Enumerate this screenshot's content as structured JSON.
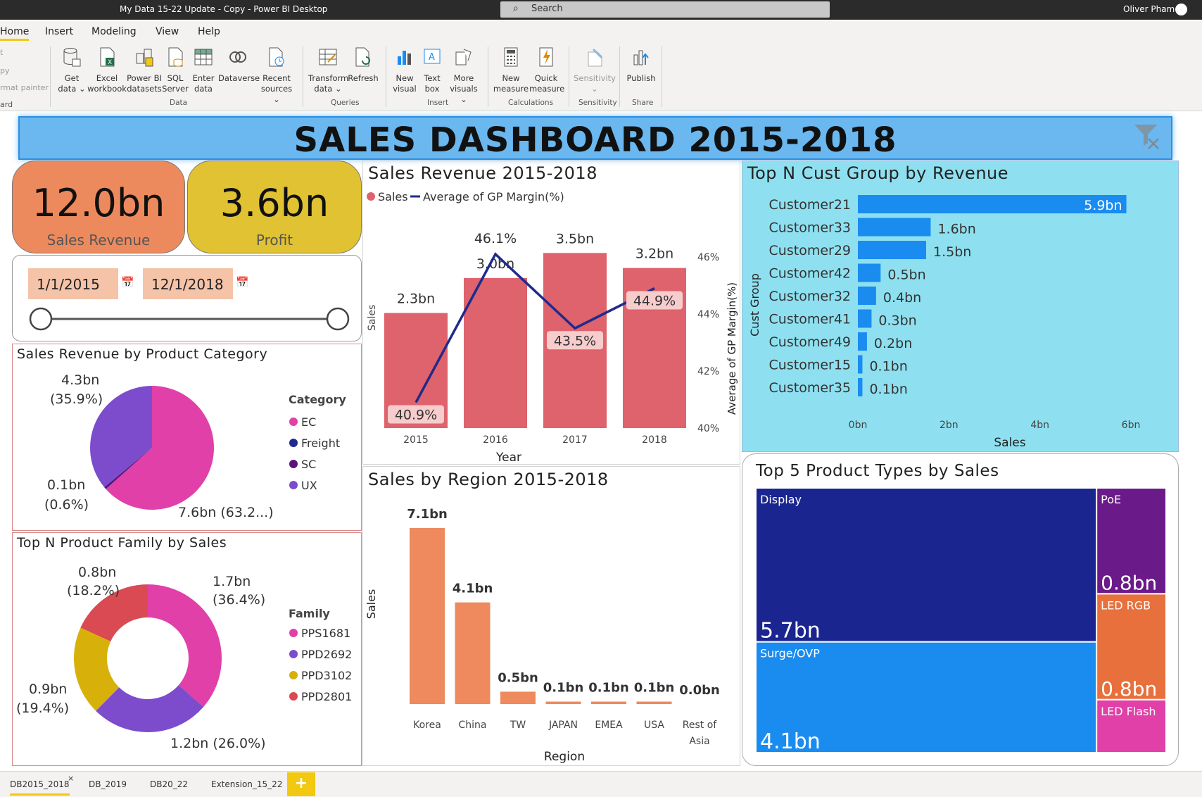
{
  "window": {
    "title": "My Data 15-22 Update - Copy - Power BI Desktop",
    "search_placeholder": "Search",
    "user": "Oliver Pham"
  },
  "menu": [
    "Home",
    "Insert",
    "Modeling",
    "View",
    "Help"
  ],
  "ribbon": {
    "clipboard": [
      "t",
      "py",
      "rmat painter",
      "ard"
    ],
    "buttons": [
      {
        "l1": "Get",
        "l2": "data ⌄",
        "icon": "database-icon"
      },
      {
        "l1": "Excel",
        "l2": "workbook",
        "icon": "excel-icon"
      },
      {
        "l1": "Power BI",
        "l2": "datasets",
        "icon": "dataset-icon"
      },
      {
        "l1": "SQL",
        "l2": "Server",
        "icon": "sql-server-icon"
      },
      {
        "l1": "Enter",
        "l2": "data",
        "icon": "table-icon"
      },
      {
        "l1": "Dataverse",
        "l2": "",
        "icon": "dataverse-icon"
      },
      {
        "l1": "Recent",
        "l2": "sources ⌄",
        "icon": "recent-sources-icon"
      },
      {
        "l1": "Transform",
        "l2": "data ⌄",
        "icon": "transform-icon"
      },
      {
        "l1": "Refresh",
        "l2": "",
        "icon": "refresh-icon"
      },
      {
        "l1": "New",
        "l2": "visual",
        "icon": "new-visual-icon"
      },
      {
        "l1": "Text",
        "l2": "box",
        "icon": "text-box-icon"
      },
      {
        "l1": "More",
        "l2": "visuals ⌄",
        "icon": "more-visuals-icon"
      },
      {
        "l1": "New",
        "l2": "measure",
        "icon": "calculator-icon"
      },
      {
        "l1": "Quick",
        "l2": "measure",
        "icon": "quick-measure-icon"
      },
      {
        "l1": "Sensitivity",
        "l2": "⌄",
        "icon": "sensitivity-icon"
      },
      {
        "l1": "Publish",
        "l2": "",
        "icon": "publish-icon"
      }
    ],
    "groups": [
      "Data",
      "Queries",
      "Insert",
      "Calculations",
      "Sensitivity",
      "Share"
    ]
  },
  "dashboard": {
    "title": "SALES DASHBOARD 2015-2018",
    "kpis": [
      {
        "value": "12.0bn",
        "label": "Sales Revenue",
        "color": "#ed8a5d"
      },
      {
        "value": "3.6bn",
        "label": "Profit",
        "color": "#e1c232"
      }
    ],
    "date_slicer": {
      "start": "1/1/2015",
      "end": "12/1/2018"
    },
    "panels": {
      "revenue_trend": "Sales Revenue 2015-2018",
      "cust_group": "Top N Cust Group by Revenue",
      "product_category": "Sales Revenue by Product Category",
      "region": "Sales by Region 2015-2018",
      "product_family": "Top N Product Family by Sales",
      "product_types": "Top 5 Product Types by Sales"
    }
  },
  "chart_data": [
    {
      "type": "bar",
      "title": "Sales Revenue 2015-2018",
      "xlabel": "Year",
      "ylabel": "Sales",
      "y2label": "Average of GP Margin(%)",
      "legend": [
        "Sales",
        "Average of GP Margin(%)"
      ],
      "categories": [
        "2015",
        "2016",
        "2017",
        "2018"
      ],
      "series": [
        {
          "name": "Sales",
          "values": [
            2.3,
            3.0,
            3.5,
            3.2
          ],
          "labels": [
            "2.3bn",
            "3.0bn",
            "3.5bn",
            "3.2bn"
          ],
          "color": "#de636c"
        },
        {
          "name": "Average of GP Margin(%)",
          "values": [
            40.9,
            46.1,
            43.5,
            44.9
          ],
          "labels": [
            "40.9%",
            "46.1%",
            "43.5%",
            "44.9%"
          ],
          "color": "#1f2a8c"
        }
      ],
      "y2ticks": [
        "46%",
        "44%",
        "42%",
        "40%"
      ],
      "y2lim": [
        40,
        47
      ]
    },
    {
      "type": "bar",
      "title": "Top N Cust Group by Revenue",
      "xlabel": "Sales",
      "ylabel": "Cust Group",
      "categories": [
        "Customer21",
        "Customer33",
        "Customer29",
        "Customer42",
        "Customer32",
        "Customer41",
        "Customer49",
        "Customer15",
        "Customer35"
      ],
      "values": [
        5.9,
        1.6,
        1.5,
        0.5,
        0.4,
        0.3,
        0.2,
        0.1,
        0.1
      ],
      "labels": [
        "5.9bn",
        "1.6bn",
        "1.5bn",
        "0.5bn",
        "0.4bn",
        "0.3bn",
        "0.2bn",
        "0.1bn",
        "0.1bn"
      ],
      "xticks": [
        "0bn",
        "2bn",
        "4bn",
        "6bn"
      ],
      "xlim": [
        0,
        6
      ],
      "color": "#1a8cf0"
    },
    {
      "type": "pie",
      "title": "Sales Revenue by Product Category",
      "legend_title": "Category",
      "categories": [
        "EC",
        "Freight",
        "SC",
        "UX"
      ],
      "values": [
        63.2,
        0.05,
        0.6,
        35.9
      ],
      "colors": [
        "#e040a8",
        "#1f2a8c",
        "#5a137d",
        "#7c4ccc"
      ],
      "labels": [
        "7.6bn (63.2...)",
        "0.1bn",
        "(0.6%)",
        "4.3bn",
        "(35.9%)"
      ]
    },
    {
      "type": "bar",
      "title": "Sales by Region 2015-2018",
      "xlabel": "Region",
      "ylabel": "Sales",
      "categories": [
        "Korea",
        "China",
        "TW",
        "JAPAN",
        "EMEA",
        "USA",
        "Rest of Asia"
      ],
      "values": [
        7.1,
        4.1,
        0.5,
        0.1,
        0.1,
        0.1,
        0.0
      ],
      "labels": [
        "7.1bn",
        "4.1bn",
        "0.5bn",
        "0.1bn",
        "0.1bn",
        "0.1bn",
        "0.0bn"
      ],
      "color": "#ee8a5e"
    },
    {
      "type": "pie",
      "title": "Top N Product Family by Sales",
      "legend_title": "Family",
      "categories": [
        "PPS1681",
        "PPD2692",
        "PPD3102",
        "PPD2801"
      ],
      "values": [
        36.4,
        26.0,
        19.4,
        18.2
      ],
      "colors": [
        "#e040a8",
        "#7c4ccc",
        "#d8b00a",
        "#d94a52"
      ],
      "labels": [
        "1.7bn",
        "(36.4%)",
        "1.2bn (26.0%)",
        "0.9bn",
        "(19.4%)",
        "0.8bn",
        "(18.2%)"
      ]
    },
    {
      "type": "treemap",
      "title": "Top 5 Product Types by Sales",
      "categories": [
        "Display",
        "Surge/OVP",
        "PoE",
        "LED RGB",
        "LED Flash"
      ],
      "values": [
        5.7,
        4.1,
        0.8,
        0.8,
        0.4
      ],
      "labels": [
        "5.7bn",
        "4.1bn",
        "0.8bn",
        "0.8bn",
        ""
      ],
      "colors": [
        "#1a2590",
        "#1a8cf0",
        "#6b1a8a",
        "#e8703c",
        "#e040a8"
      ]
    }
  ],
  "pages": [
    "DB2015_2018",
    "DB_2019",
    "DB20_22",
    "Extension_15_22"
  ],
  "add_page": "+"
}
